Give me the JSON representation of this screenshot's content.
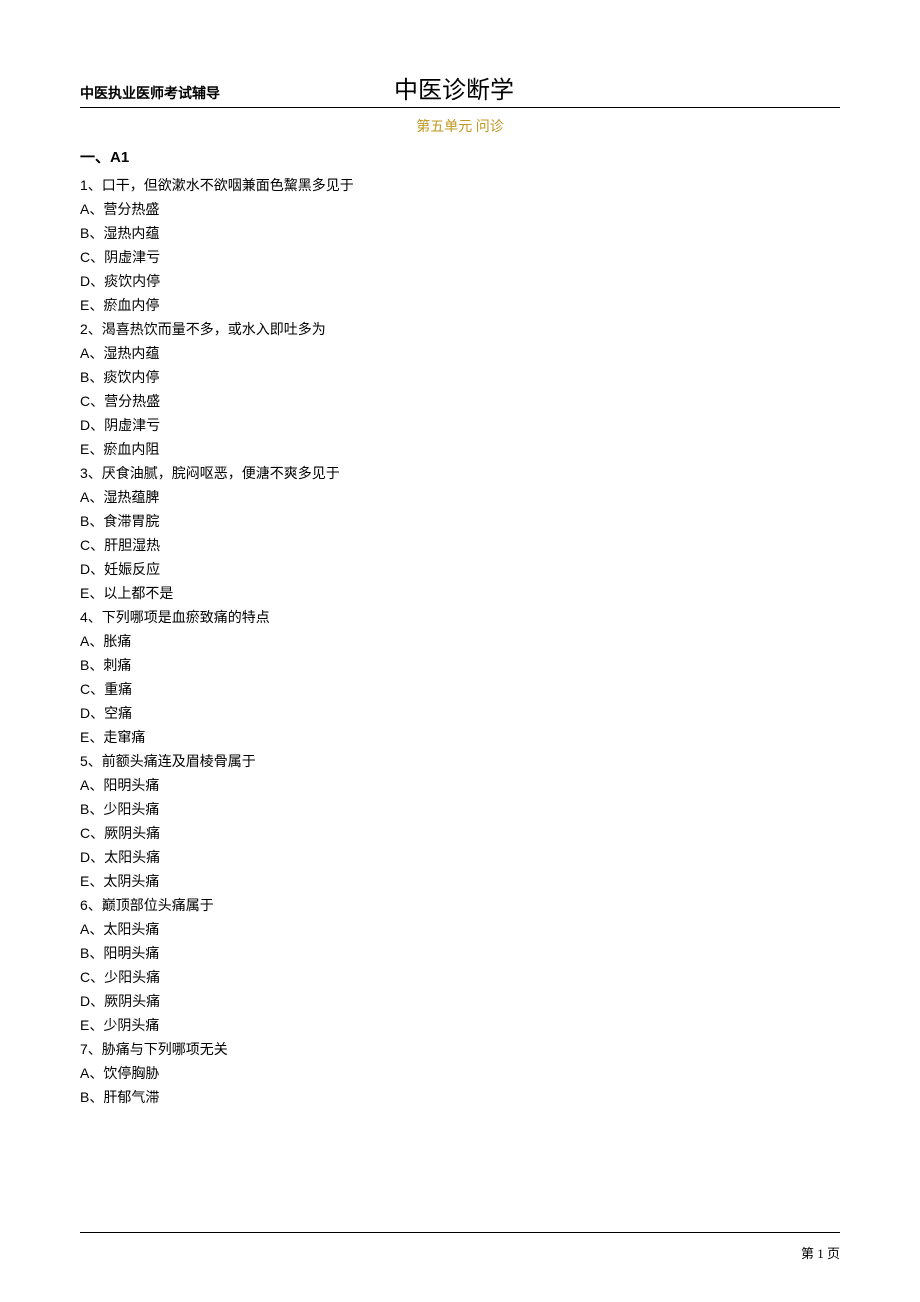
{
  "header": {
    "left": "中医执业医师考试辅导",
    "center": "中医诊断学"
  },
  "unit_title": "第五单元  问诊",
  "section_label": "一、A1",
  "questions": [
    {
      "num": "1",
      "text": "、口干，但欲漱水不欲咽兼面色黧黑多见于",
      "options": [
        {
          "letter": "A",
          "text": "、营分热盛"
        },
        {
          "letter": "B",
          "text": "、湿热内蕴"
        },
        {
          "letter": "C",
          "text": "、阴虚津亏"
        },
        {
          "letter": "D",
          "text": "、痰饮内停"
        },
        {
          "letter": "E",
          "text": "、瘀血内停"
        }
      ]
    },
    {
      "num": "2",
      "text": "、渴喜热饮而量不多，或水入即吐多为",
      "options": [
        {
          "letter": "A",
          "text": "、湿热内蕴"
        },
        {
          "letter": "B",
          "text": "、痰饮内停"
        },
        {
          "letter": "C",
          "text": "、营分热盛"
        },
        {
          "letter": "D",
          "text": "、阴虚津亏"
        },
        {
          "letter": "E",
          "text": "、瘀血内阻"
        }
      ]
    },
    {
      "num": "3",
      "text": "、厌食油腻，脘闷呕恶，便溏不爽多见于",
      "options": [
        {
          "letter": "A",
          "text": "、湿热蕴脾"
        },
        {
          "letter": "B",
          "text": "、食滞胃脘"
        },
        {
          "letter": "C",
          "text": "、肝胆湿热"
        },
        {
          "letter": "D",
          "text": "、妊娠反应"
        },
        {
          "letter": "E",
          "text": "、以上都不是"
        }
      ]
    },
    {
      "num": "4",
      "text": "、下列哪项是血瘀致痛的特点",
      "options": [
        {
          "letter": "A",
          "text": "、胀痛"
        },
        {
          "letter": "B",
          "text": "、刺痛"
        },
        {
          "letter": "C",
          "text": "、重痛"
        },
        {
          "letter": "D",
          "text": "、空痛"
        },
        {
          "letter": "E",
          "text": "、走窜痛"
        }
      ]
    },
    {
      "num": "5",
      "text": "、前额头痛连及眉棱骨属于",
      "options": [
        {
          "letter": "A",
          "text": "、阳明头痛"
        },
        {
          "letter": "B",
          "text": "、少阳头痛"
        },
        {
          "letter": "C",
          "text": "、厥阴头痛"
        },
        {
          "letter": "D",
          "text": "、太阳头痛"
        },
        {
          "letter": "E",
          "text": "、太阴头痛"
        }
      ]
    },
    {
      "num": "6",
      "text": "、巅顶部位头痛属于",
      "options": [
        {
          "letter": "A",
          "text": "、太阳头痛"
        },
        {
          "letter": "B",
          "text": "、阳明头痛"
        },
        {
          "letter": "C",
          "text": "、少阳头痛"
        },
        {
          "letter": "D",
          "text": "、厥阴头痛"
        },
        {
          "letter": "E",
          "text": "、少阴头痛"
        }
      ]
    },
    {
      "num": "7",
      "text": "、胁痛与下列哪项无关",
      "options": [
        {
          "letter": "A",
          "text": "、饮停胸胁"
        },
        {
          "letter": "B",
          "text": "、肝郁气滞"
        }
      ]
    }
  ],
  "footer": {
    "page": "第 1 页"
  }
}
